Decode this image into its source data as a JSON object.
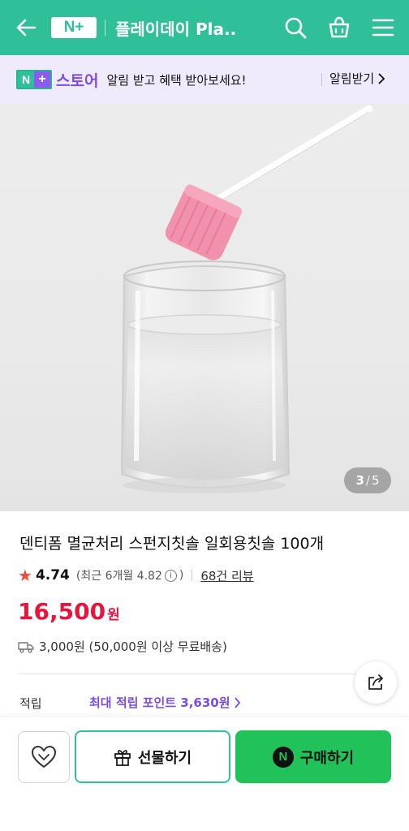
{
  "header": {
    "brand": "N+",
    "title": "플레이데이 Pla...",
    "icons": [
      "back-arrow-icon",
      "search-icon",
      "shopping-bag-icon",
      "menu-icon"
    ],
    "bg_color": "#2fc09a"
  },
  "alert_bar": {
    "logo_n": "N",
    "logo_plus": "+",
    "store_label": "스토어",
    "message": "알림 받고 혜택 받아보세요!",
    "subscribe_label": "알림받기",
    "bg_color": "#efeafc"
  },
  "gallery": {
    "current": "3",
    "separator": "/",
    "total": "5"
  },
  "product": {
    "title": "덴티폼 멸균처리 스펀지칫솔 일회용칫솔 100개",
    "rating": "4.74",
    "recent_rating": "(최근 6개월 4.82",
    "recent_close": ")",
    "review_count": "68건 리뷰",
    "price": "16,500",
    "currency": "원",
    "shipping": "3,000원 (50,000원 이상 무료배송)",
    "points_label": "적립",
    "points_value": "최대 적립 포인트 3,630원",
    "price_color": "#e6153d",
    "points_color": "#7a4de8"
  },
  "actions": {
    "gift_label": "선물하기",
    "buy_label": "구매하기",
    "buy_badge": "N",
    "buy_color": "#21c25a"
  }
}
